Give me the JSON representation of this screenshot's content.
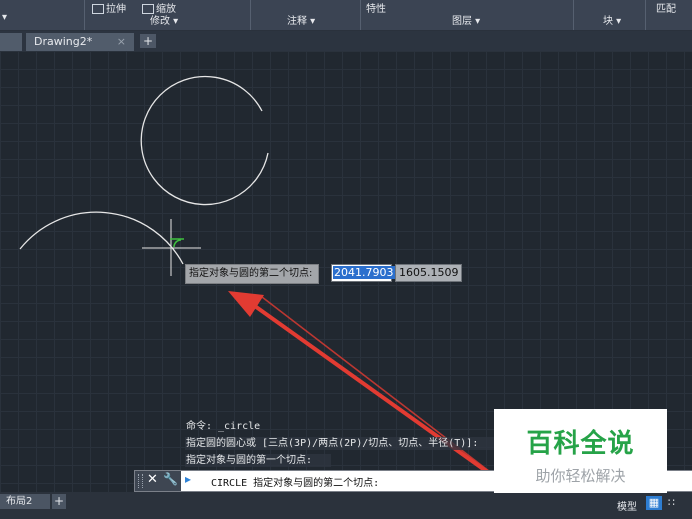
{
  "ribbon": {
    "panels": [
      "修改 ▾",
      "注释 ▾",
      "图层 ▾",
      "块 ▾"
    ],
    "tools": [
      "拉伸",
      "缩放",
      "特性",
      "匹配"
    ]
  },
  "tabs": {
    "document_tab": "Drawing2*",
    "close": "×",
    "new_tab": "+"
  },
  "tooltip": {
    "prompt": "指定对象与圆的第二个切点:",
    "x_value": "2041.7903",
    "y_value": "1605.1509"
  },
  "command_history": [
    "命令: _circle",
    "指定圆的圆心或 [三点(3P)/两点(2P)/切点、切点、半径(T)]: ",
    "指定对象与圆的第一个切点:"
  ],
  "command_line": {
    "close": "✕",
    "wrench": "🔧",
    "prompt_icon": "▸",
    "text": "CIRCLE 指定对象与圆的第二个切点:"
  },
  "statusbar": {
    "layout_tab": "布局2",
    "layout_plus": "+",
    "model": "模型",
    "grid": "▦",
    "snap": "∷"
  },
  "watermark": {
    "title": "百科全说",
    "subtitle": "助你轻松解决"
  },
  "colors": {
    "canvas": "#212830",
    "arrow": "#e23b32",
    "tangent_marker": "#3fbf3f",
    "cmd_blue": "#2e7dd1"
  }
}
